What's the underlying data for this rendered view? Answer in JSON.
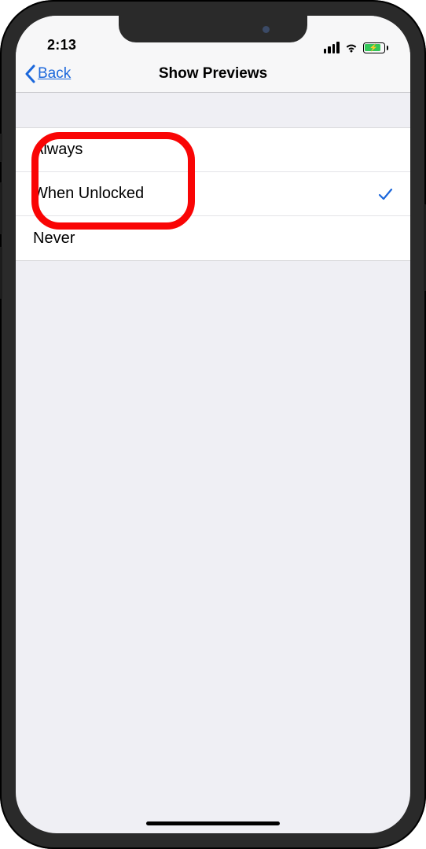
{
  "statusBar": {
    "time": "2:13"
  },
  "nav": {
    "back_label": "Back",
    "title": "Show Previews"
  },
  "options": [
    {
      "label": "Always",
      "selected": false
    },
    {
      "label": "When Unlocked",
      "selected": true
    },
    {
      "label": "Never",
      "selected": false
    }
  ],
  "colors": {
    "accent": "#1b67db",
    "battery_fill": "#34c759",
    "highlight": "#f90505"
  }
}
